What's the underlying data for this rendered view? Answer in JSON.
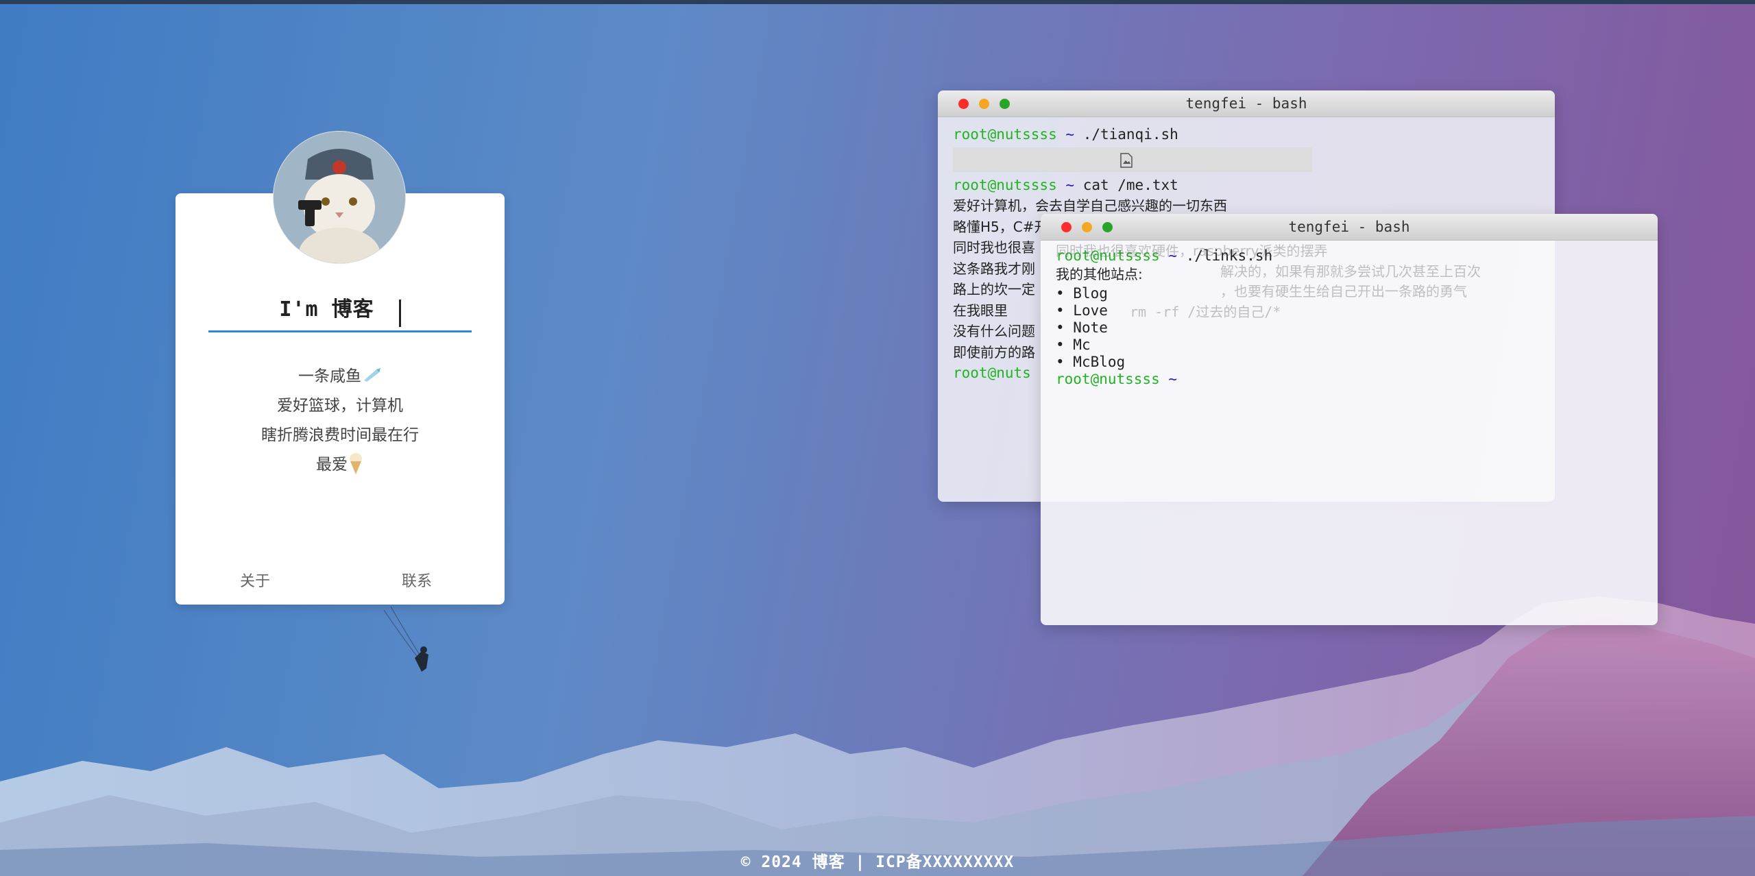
{
  "card": {
    "title": "I'm 博客",
    "bio": [
      "一条咸鱼",
      "爱好篮球，计算机",
      "瞎折腾浪费时间最在行",
      "最爱"
    ],
    "links": {
      "about": "关于",
      "contact": "联系"
    }
  },
  "terminal1": {
    "title": "tengfei - bash",
    "prompt_user": "root@nutssss",
    "prompt_tilde": "~",
    "cmd1": "./tianqi.sh",
    "cmd2": "cat /me.txt",
    "lines": [
      "爱好计算机，会去自学自己感兴趣的一切东西",
      "略懂H5，C#开",
      "同时我也很喜",
      "这条路我才刚",
      "路上的坎一定",
      "在我眼里",
      "没有什么问题",
      "即使前方的路"
    ],
    "prompt3_user": "root@nuts",
    "ghost_line": "同时我也很喜欢硬件，raspberry派类的摆弄",
    "ghost_line2": "解决的，如果有那就多尝试几次甚至上百次",
    "ghost_line3": "，也要有硬生生给自己开出一条路的勇气",
    "ghost_cmd": "rm -rf /过去的自己/*"
  },
  "terminal2": {
    "title": "tengfei - bash",
    "prompt_user": "root@nutssss",
    "prompt_tilde": "~",
    "cmd": "./links.sh",
    "heading": "我的其他站点:",
    "links": [
      "Blog",
      "Love",
      "Note",
      "Mc",
      "McBlog"
    ]
  },
  "footer": {
    "text": "© 2024 博客 | ICP备XXXXXXXXX"
  }
}
